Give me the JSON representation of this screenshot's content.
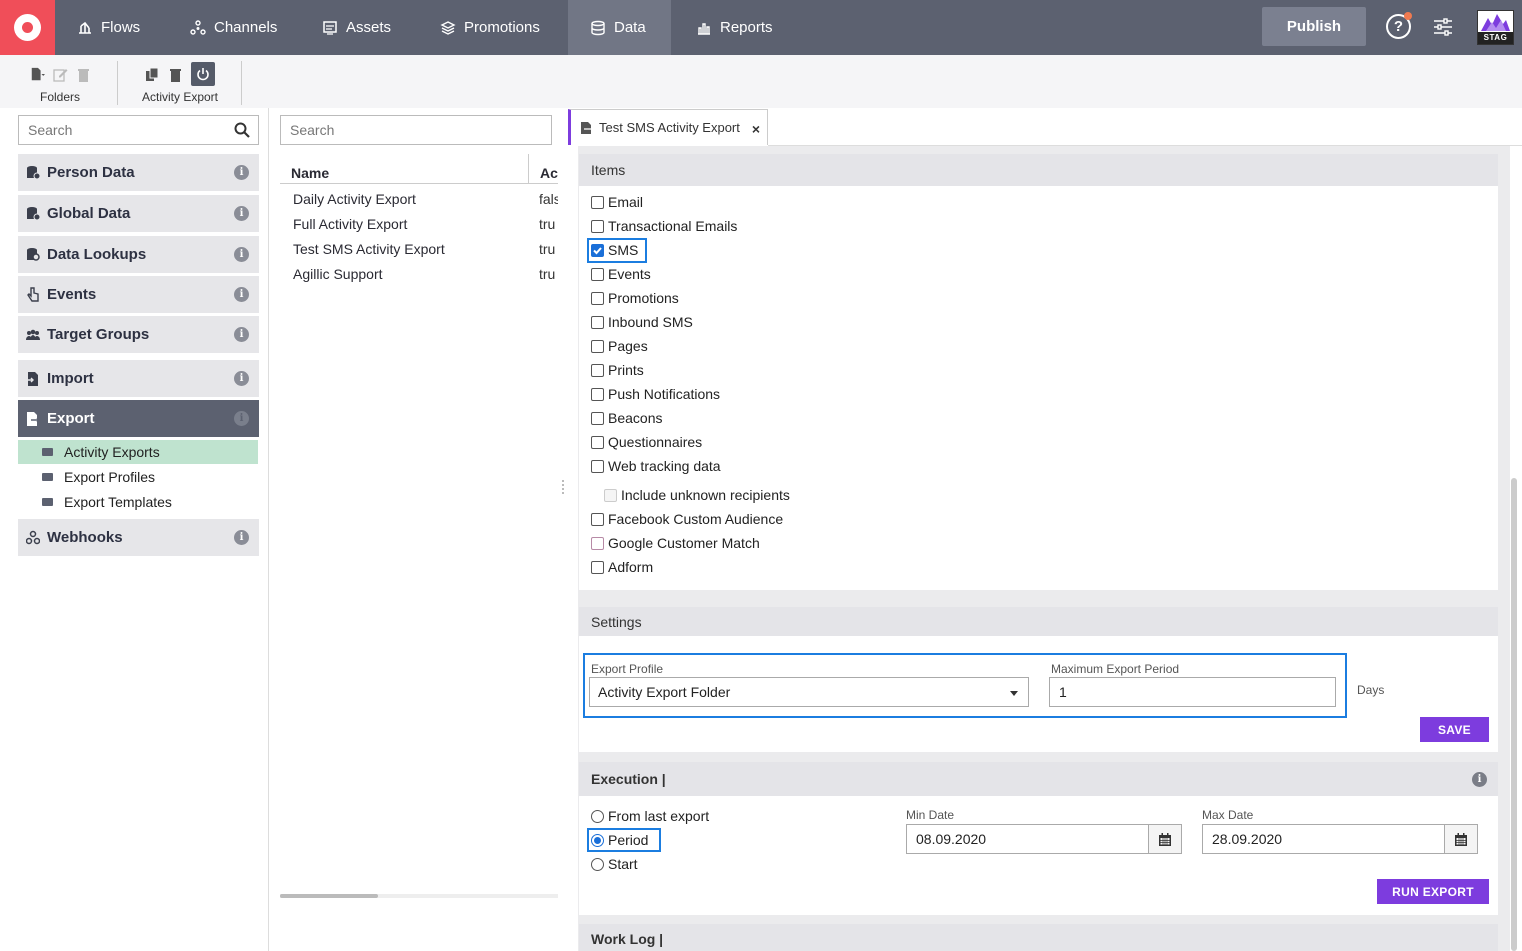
{
  "nav": {
    "items": [
      {
        "label": "Flows",
        "icon": "flows-icon"
      },
      {
        "label": "Channels",
        "icon": "channels-icon"
      },
      {
        "label": "Assets",
        "icon": "assets-icon"
      },
      {
        "label": "Promotions",
        "icon": "promotions-icon"
      },
      {
        "label": "Data",
        "icon": "database-icon",
        "active": true
      },
      {
        "label": "Reports",
        "icon": "reports-icon"
      }
    ],
    "publish_label": "Publish",
    "help_label": "?",
    "env_badge": "STAG"
  },
  "toolbar": {
    "folders_label": "Folders",
    "activity_export_label": "Activity Export"
  },
  "left": {
    "search_placeholder": "Search",
    "categories": [
      {
        "label": "Person Data"
      },
      {
        "label": "Global Data"
      },
      {
        "label": "Data Lookups"
      },
      {
        "label": "Events"
      },
      {
        "label": "Target Groups"
      },
      {
        "label": "Import"
      },
      {
        "label": "Export"
      },
      {
        "label": "Webhooks"
      }
    ],
    "info_glyph": "i",
    "export_children": [
      {
        "label": "Activity Exports",
        "selected": true
      },
      {
        "label": "Export Profiles"
      },
      {
        "label": "Export Templates"
      }
    ]
  },
  "middle": {
    "search_placeholder": "Search",
    "columns": [
      "Name",
      "Ac"
    ],
    "rows": [
      {
        "name": "Daily Activity Export",
        "active": "fals"
      },
      {
        "name": "Full Activity Export",
        "active": "tru"
      },
      {
        "name": "Test SMS Activity Export",
        "active": "tru"
      },
      {
        "name": "Agillic Support",
        "active": "tru"
      }
    ]
  },
  "editor": {
    "tab_title": "Test SMS Activity Export",
    "tab_close": "×",
    "items_header": "Items",
    "items": [
      {
        "label": "Email",
        "checked": false
      },
      {
        "label": "Transactional Emails",
        "checked": false
      },
      {
        "label": "SMS",
        "checked": true
      },
      {
        "label": "Events",
        "checked": false
      },
      {
        "label": "Promotions",
        "checked": false
      },
      {
        "label": "Inbound SMS",
        "checked": false
      },
      {
        "label": "Pages",
        "checked": false
      },
      {
        "label": "Prints",
        "checked": false
      },
      {
        "label": "Push Notifications",
        "checked": false
      },
      {
        "label": "Beacons",
        "checked": false
      },
      {
        "label": "Questionnaires",
        "checked": false
      },
      {
        "label": "Web tracking data",
        "checked": false
      },
      {
        "label": "Include unknown recipients",
        "checked": false,
        "disabled": true
      },
      {
        "label": "Facebook Custom Audience",
        "checked": false
      },
      {
        "label": "Google Customer Match",
        "checked": false
      },
      {
        "label": "Adform",
        "checked": false
      }
    ],
    "settings_header": "Settings",
    "export_profile_label": "Export Profile",
    "export_profile_value": "Activity Export Folder",
    "max_period_label": "Maximum Export Period",
    "max_period_value": "1",
    "days_unit": "Days",
    "save_label": "SAVE",
    "execution_header": "Execution |",
    "execution_options": [
      {
        "label": "From last export",
        "selected": false
      },
      {
        "label": "Period",
        "selected": true
      },
      {
        "label": "Start",
        "selected": false
      }
    ],
    "min_date_label": "Min Date",
    "min_date_value": "08.09.2020",
    "max_date_label": "Max Date",
    "max_date_value": "28.09.2020",
    "run_label": "RUN EXPORT",
    "worklog_header": "Work Log |"
  },
  "colors": {
    "topbar": "#5c6170",
    "logo": "#f04e59",
    "accent": "#7d3cde",
    "highlight": "#1b7de0",
    "selected_row": "#bfe3cf"
  }
}
